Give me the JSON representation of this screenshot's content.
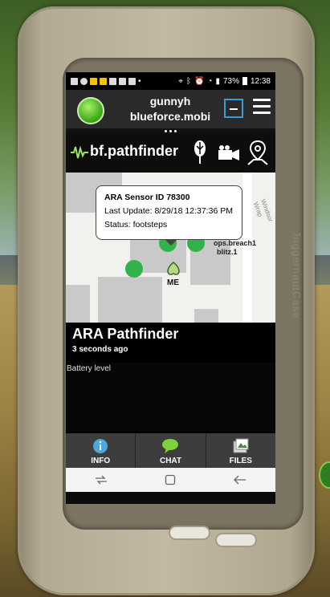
{
  "status_bar": {
    "battery": "73%",
    "time": "12:38"
  },
  "account": {
    "username": "gunnyh",
    "domain": "blueforce.mobi"
  },
  "app": {
    "title": "bf.pathfinder"
  },
  "map": {
    "popup": {
      "title": "ARA Sensor ID 78300",
      "last_update": "Last Update: 8/29/18 12:37:36 PM",
      "status": "Status: footsteps"
    },
    "labels": {
      "me": "ME",
      "callsign_1": "ops.breach1",
      "callsign_2": "blitz.1",
      "street": "Windsor Wrap"
    }
  },
  "info_panel": {
    "title": "ARA Pathfinder",
    "updated": "3 seconds ago",
    "battery_label": "Battery level"
  },
  "tabs": [
    {
      "label": "INFO",
      "icon": "info-icon"
    },
    {
      "label": "CHAT",
      "icon": "chat-icon"
    },
    {
      "label": "FILES",
      "icon": "files-icon"
    }
  ],
  "case": {
    "brand": "JuggernautCase"
  },
  "colors": {
    "accent": "#3a9bd9",
    "pin_green": "#2fb34a",
    "app_bar": "#0d0d0d"
  }
}
